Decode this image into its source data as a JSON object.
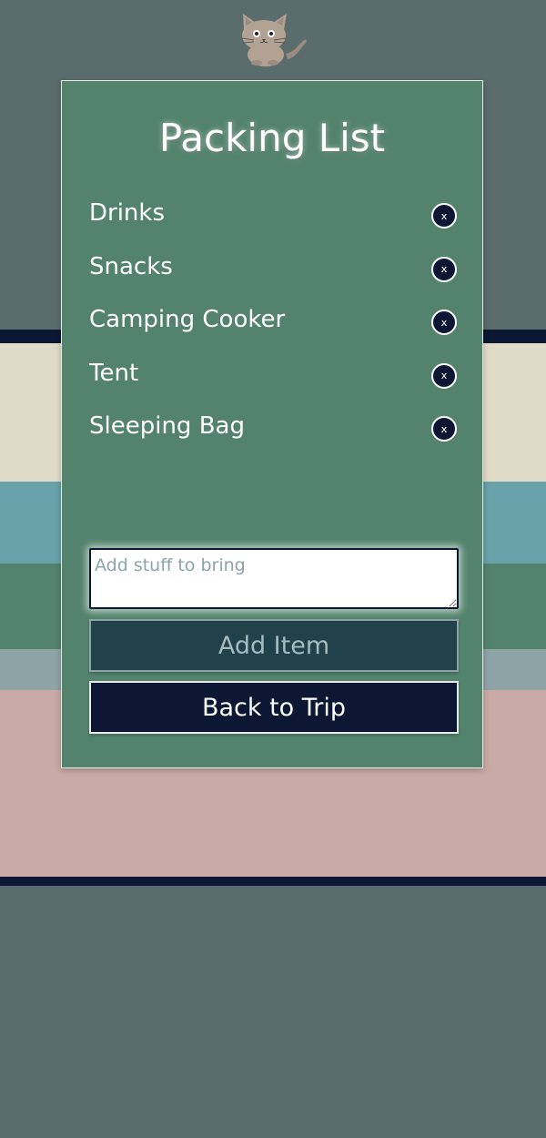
{
  "card": {
    "title": "Packing List",
    "items": [
      {
        "label": "Drinks",
        "remove_label": "x"
      },
      {
        "label": "Snacks",
        "remove_label": "x"
      },
      {
        "label": "Camping Cooker",
        "remove_label": "x"
      },
      {
        "label": "Tent",
        "remove_label": "x"
      },
      {
        "label": "Sleeping Bag",
        "remove_label": "x"
      }
    ],
    "new_item": {
      "value": "",
      "placeholder": "Add stuff to bring"
    },
    "add_button_label": "Add Item",
    "back_button_label": "Back to Trip"
  },
  "icons": {
    "mascot": "cat-icon"
  },
  "colors": {
    "page_background": "#5a6c6c",
    "card_background": "#53836d",
    "navy": "#0b1733",
    "cream": "#e0dac8",
    "teal": "#67a2a9",
    "grey": "#8ea3a5",
    "pink": "#c9aaa4",
    "add_button_background": "#22424b"
  }
}
